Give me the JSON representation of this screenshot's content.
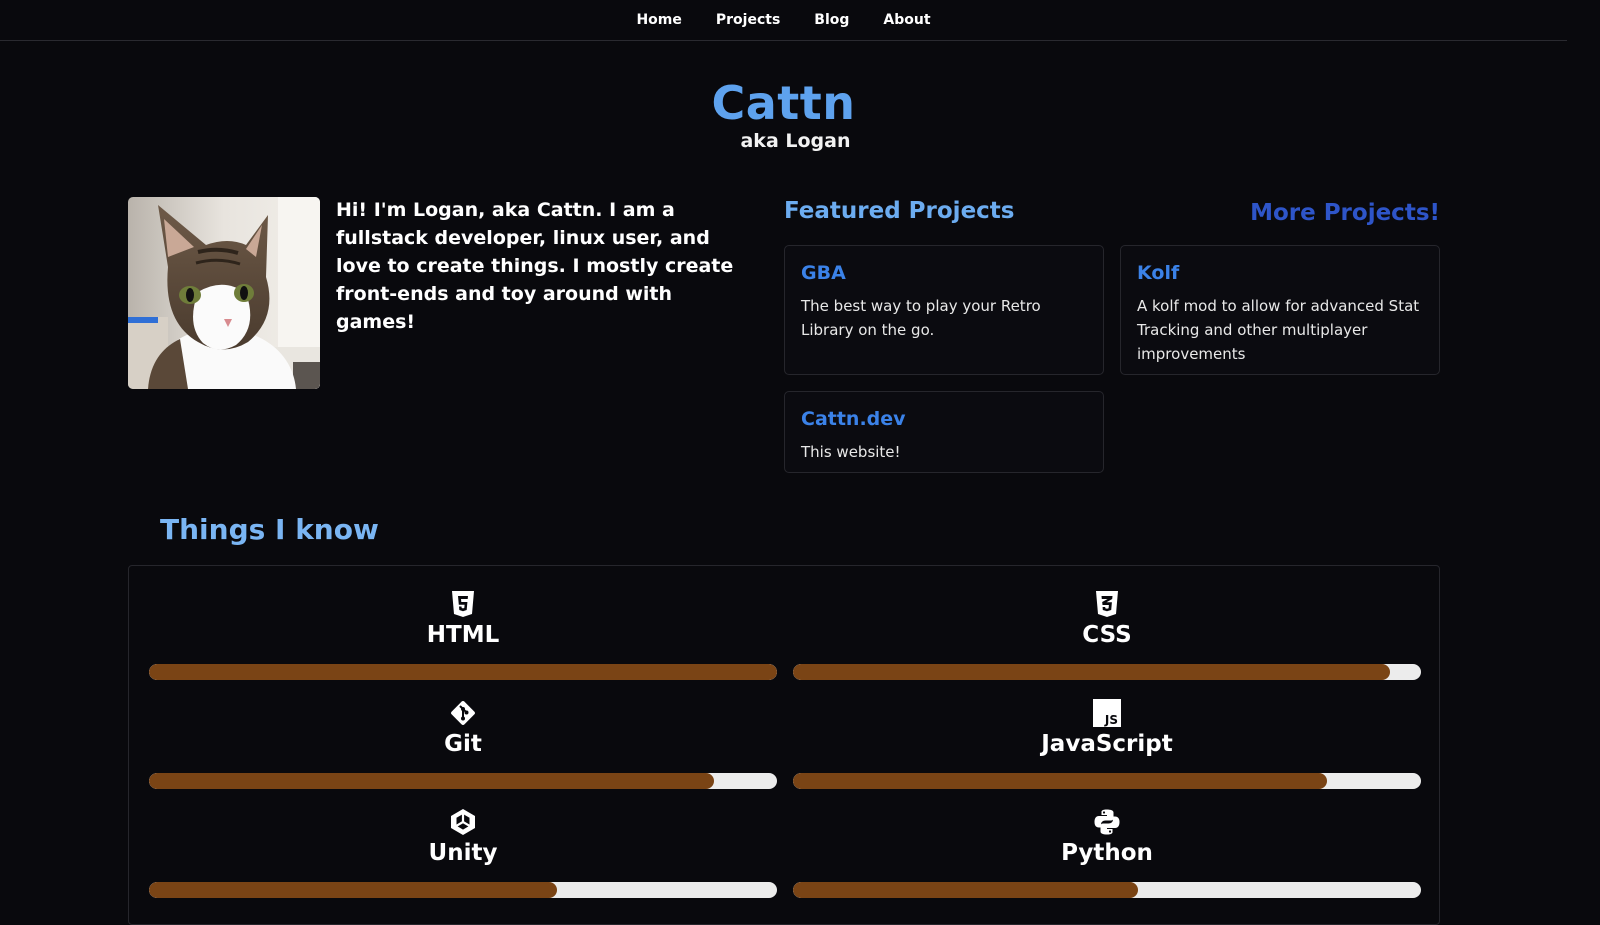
{
  "nav": {
    "items": [
      {
        "label": "Home"
      },
      {
        "label": "Projects"
      },
      {
        "label": "Blog"
      },
      {
        "label": "About"
      }
    ]
  },
  "header": {
    "title": "Cattn",
    "subtitle": "aka Logan"
  },
  "intro": {
    "text": "Hi! I'm Logan, aka Cattn. I am a fullstack developer, linux user, and love to create things. I mostly create front-ends and toy around with games!"
  },
  "featured": {
    "title": "Featured Projects",
    "more_label": "More Projects!",
    "projects": [
      {
        "name": "GBA",
        "description": "The best way to play your Retro Library on the go."
      },
      {
        "name": "Kolf",
        "description": "A kolf mod to allow for advanced Stat Tracking and other multiplayer improvements"
      },
      {
        "name": "Cattn.dev",
        "description": "This website!"
      }
    ]
  },
  "skills": {
    "title": "Things I know",
    "items": [
      {
        "name": "HTML",
        "icon": "html5-icon",
        "level": 1.0
      },
      {
        "name": "CSS",
        "icon": "css3-icon",
        "level": 0.95
      },
      {
        "name": "Git",
        "icon": "git-icon",
        "level": 0.9
      },
      {
        "name": "JavaScript",
        "icon": "javascript-icon",
        "level": 0.85
      },
      {
        "name": "Unity",
        "icon": "unity-icon",
        "level": 0.65
      },
      {
        "name": "Python",
        "icon": "python-icon",
        "level": 0.55
      }
    ]
  },
  "colors": {
    "background": "#09090d",
    "title": "#5ea2ee",
    "link": "#3b82e8",
    "more_link": "#2e55c9",
    "bar_fill": "#7a4415",
    "bar_track": "#ececec"
  }
}
